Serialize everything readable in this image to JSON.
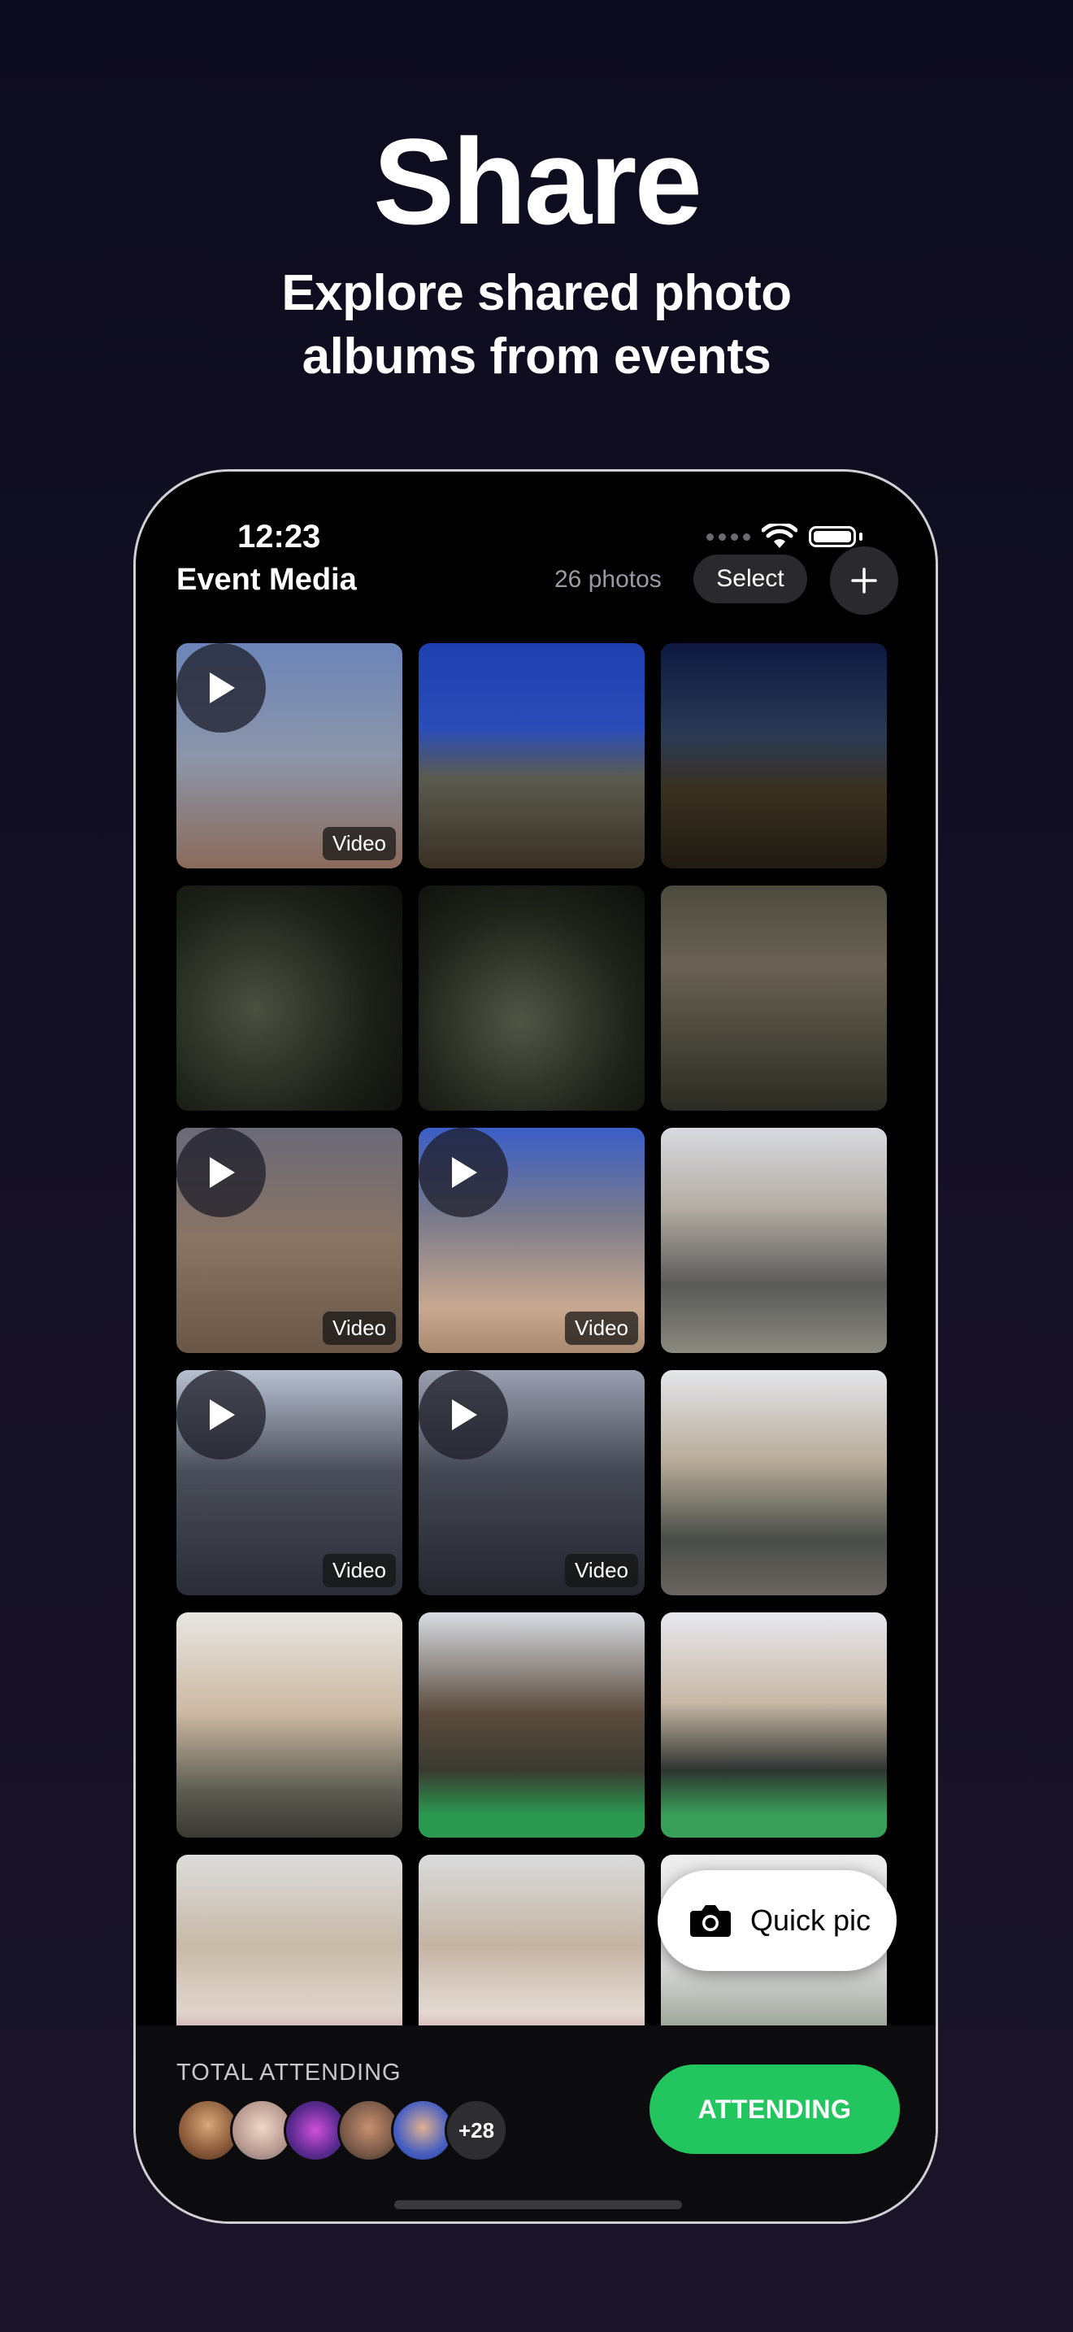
{
  "hero": {
    "title": "Share",
    "subtitle_line1": "Explore shared photo",
    "subtitle_line2": "albums from events"
  },
  "status_bar": {
    "time": "12:23"
  },
  "header": {
    "title": "Event Media",
    "photo_count": "26 photos",
    "select_label": "Select",
    "add_icon": "plus-icon"
  },
  "grid": {
    "tiles": [
      {
        "id": "t1",
        "type": "video",
        "badge": "Video"
      },
      {
        "id": "t2",
        "type": "photo"
      },
      {
        "id": "t3",
        "type": "photo"
      },
      {
        "id": "t4",
        "type": "photo"
      },
      {
        "id": "t5",
        "type": "photo"
      },
      {
        "id": "t6",
        "type": "photo"
      },
      {
        "id": "t7",
        "type": "video",
        "badge": "Video"
      },
      {
        "id": "t8",
        "type": "video",
        "badge": "Video"
      },
      {
        "id": "t9",
        "type": "photo"
      },
      {
        "id": "t10",
        "type": "video",
        "badge": "Video"
      },
      {
        "id": "t11",
        "type": "video",
        "badge": "Video"
      },
      {
        "id": "t12",
        "type": "photo"
      },
      {
        "id": "t13",
        "type": "photo"
      },
      {
        "id": "t14",
        "type": "photo"
      },
      {
        "id": "t15",
        "type": "photo"
      },
      {
        "id": "t16",
        "type": "photo"
      },
      {
        "id": "t17",
        "type": "photo"
      },
      {
        "id": "t18",
        "type": "photo"
      }
    ]
  },
  "quick_pic": {
    "label": "Quick pic",
    "icon": "camera-icon"
  },
  "footer": {
    "attending_label": "TOTAL ATTENDING",
    "more_count": "+28",
    "attending_button": "ATTENDING"
  },
  "colors": {
    "accent_green": "#22c55e",
    "background": "#0d0b1e",
    "phone_bg": "#000000"
  }
}
